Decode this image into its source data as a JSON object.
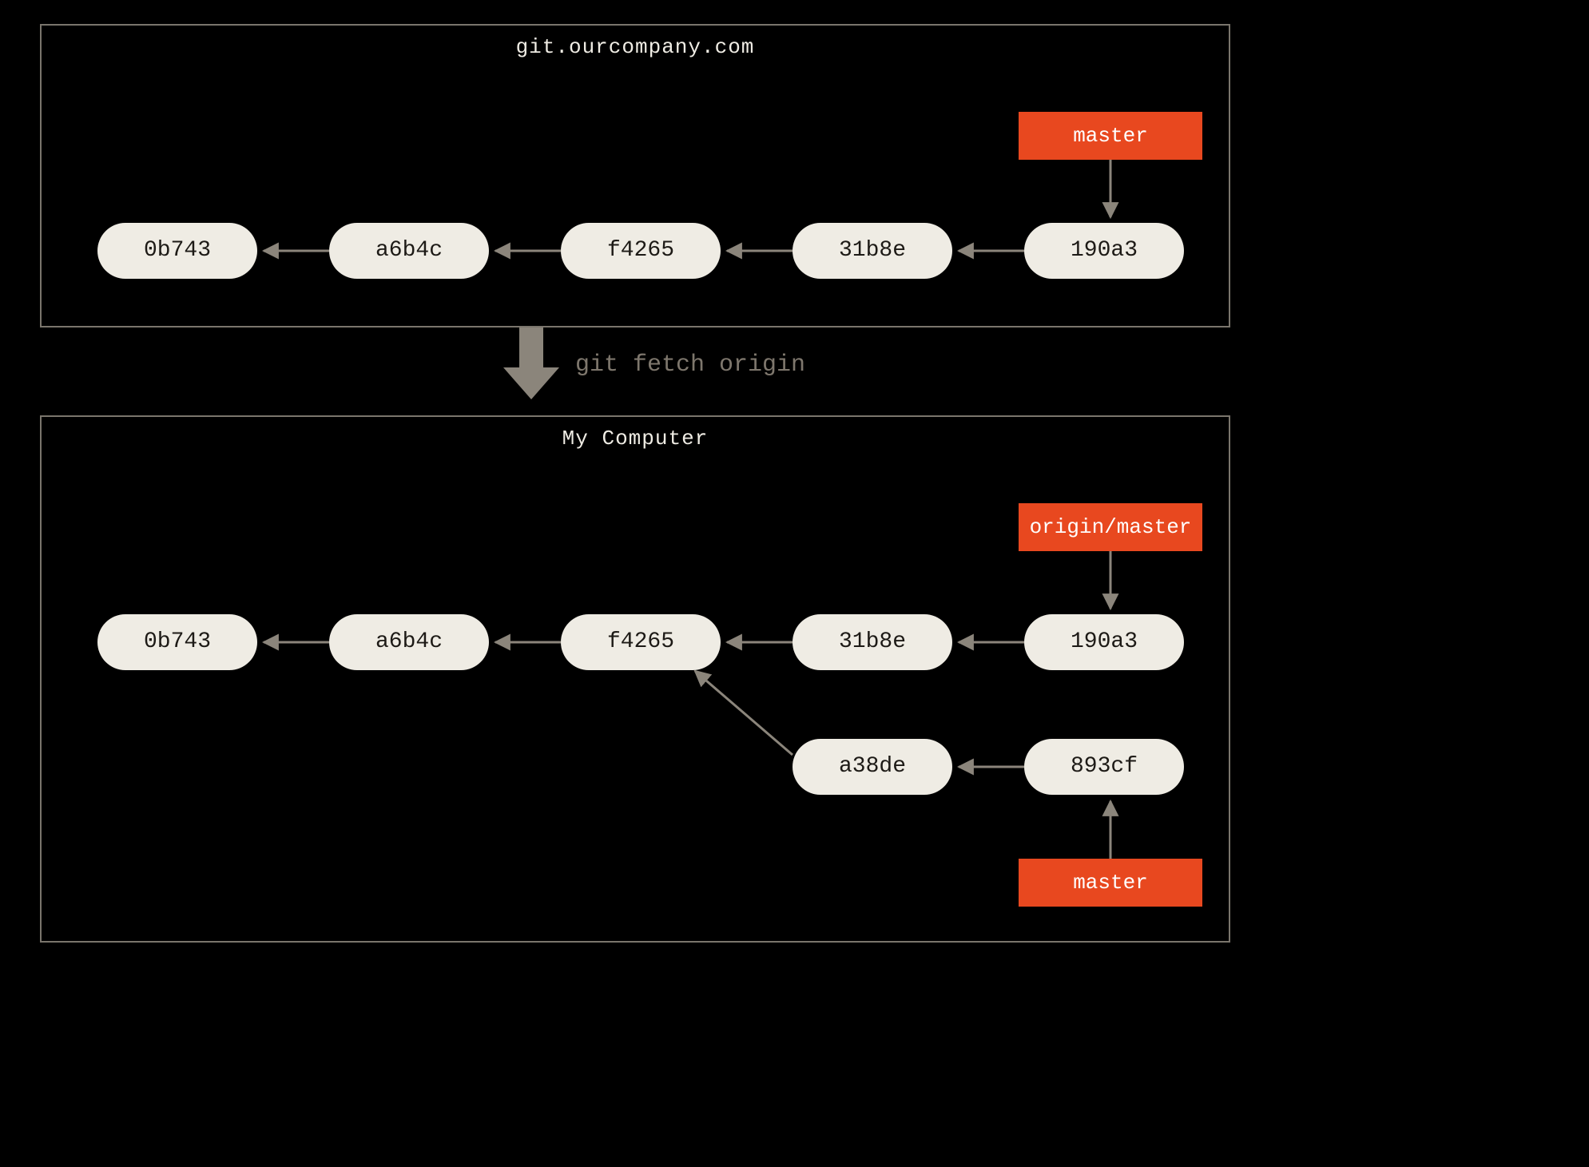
{
  "remote": {
    "title": "git.ourcompany.com",
    "ref_master": "master",
    "commits": [
      "0b743",
      "a6b4c",
      "f4265",
      "31b8e",
      "190a3"
    ]
  },
  "command": "git fetch origin",
  "local": {
    "title": "My Computer",
    "ref_origin_master": "origin/master",
    "ref_master": "master",
    "commits_main": [
      "0b743",
      "a6b4c",
      "f4265",
      "31b8e",
      "190a3"
    ],
    "commits_branch": [
      "a38de",
      "893cf"
    ]
  }
}
